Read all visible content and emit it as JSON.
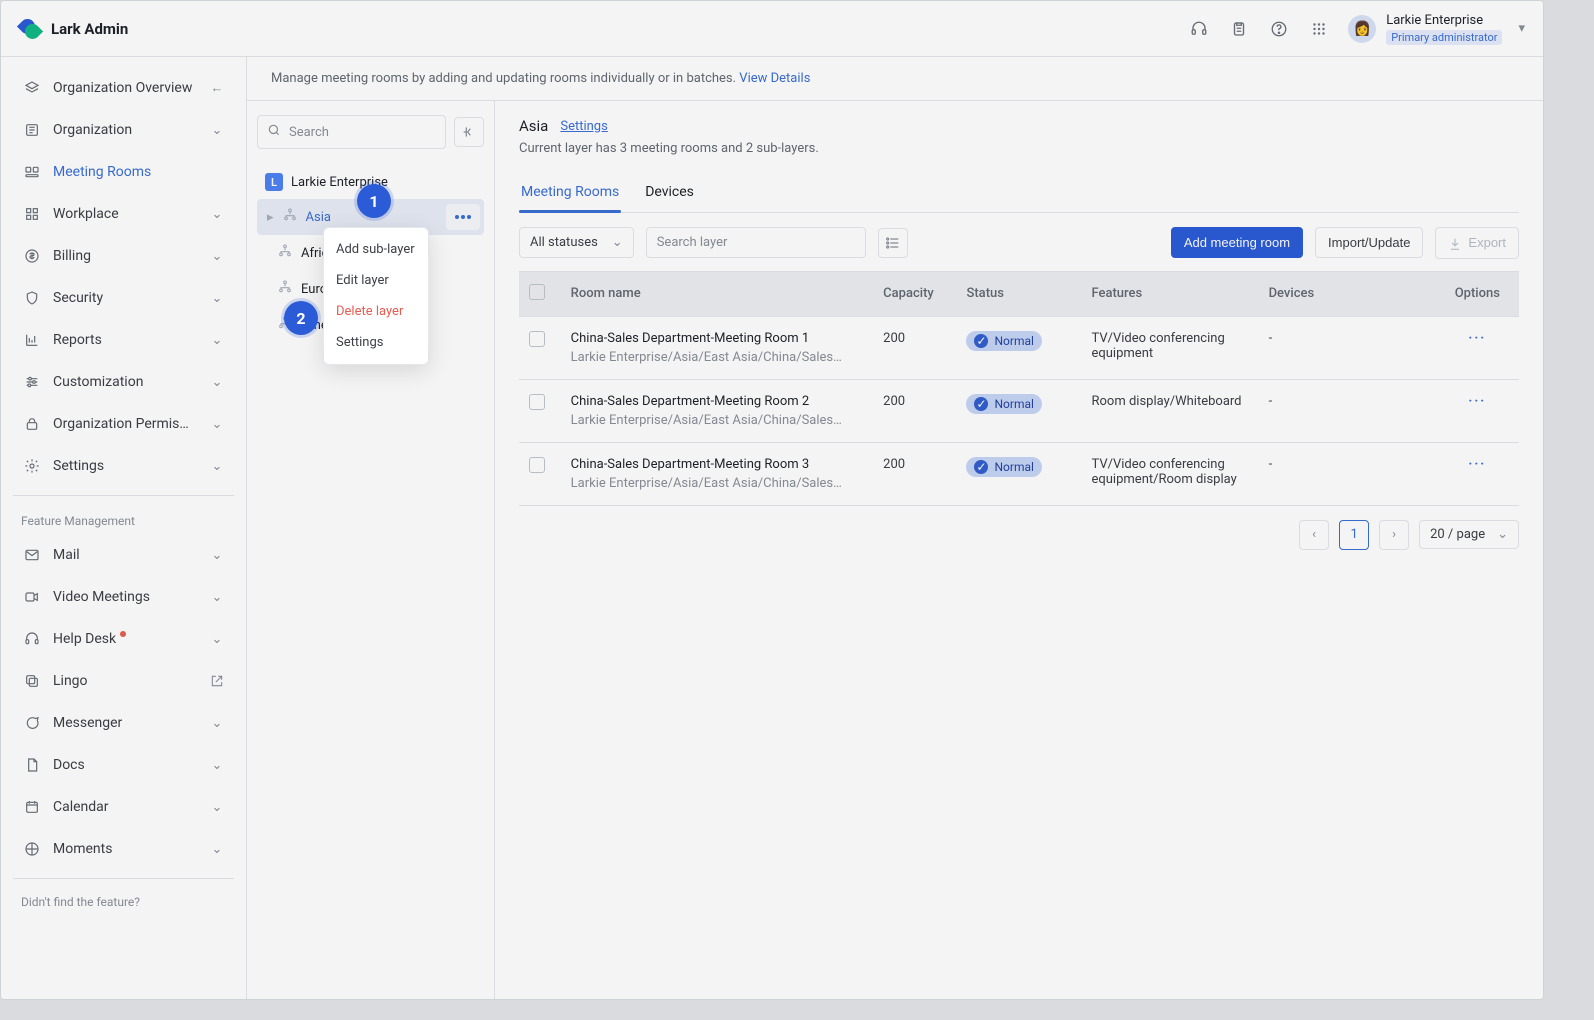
{
  "brand": {
    "name": "Lark Admin"
  },
  "user": {
    "org": "Larkie Enterprise",
    "role": "Primary administrator"
  },
  "sidebar": {
    "items": [
      {
        "label": "Organization Overview",
        "type": "back"
      },
      {
        "label": "Organization",
        "type": "expand"
      },
      {
        "label": "Meeting Rooms",
        "type": "active"
      },
      {
        "label": "Workplace",
        "type": "expand"
      },
      {
        "label": "Billing",
        "type": "expand"
      },
      {
        "label": "Security",
        "type": "expand"
      },
      {
        "label": "Reports",
        "type": "expand"
      },
      {
        "label": "Customization",
        "type": "expand"
      },
      {
        "label": "Organization Permis…",
        "type": "expand"
      },
      {
        "label": "Settings",
        "type": "expand"
      }
    ],
    "feature_title": "Feature Management",
    "features": [
      {
        "label": "Mail",
        "type": "expand"
      },
      {
        "label": "Video Meetings",
        "type": "expand"
      },
      {
        "label": "Help Desk",
        "type": "expand",
        "dot": true
      },
      {
        "label": "Lingo",
        "type": "external"
      },
      {
        "label": "Messenger",
        "type": "expand"
      },
      {
        "label": "Docs",
        "type": "expand"
      },
      {
        "label": "Calendar",
        "type": "expand"
      },
      {
        "label": "Moments",
        "type": "expand"
      }
    ],
    "didnt_find": "Didn't find the feature?"
  },
  "tip": {
    "text": "Manage meeting rooms by adding and updating rooms individually or in batches.",
    "link": "View Details"
  },
  "tree": {
    "search_placeholder": "Search",
    "org": "Larkie Enterprise",
    "nodes": [
      "Asia",
      "Africa",
      "Europe",
      "America"
    ]
  },
  "flyout": {
    "0": "Add sub-layer",
    "1": "Edit layer",
    "2": "Delete layer",
    "3": "Settings"
  },
  "callouts": {
    "one": "1",
    "two": "2"
  },
  "main": {
    "title": "Asia",
    "settings": "Settings",
    "desc": "Current layer has 3 meeting rooms and 2 sub-layers.",
    "tabs": [
      "Meeting Rooms",
      "Devices"
    ],
    "filter_all": "All statuses",
    "search_placeholder": "Search layer",
    "buttons": {
      "add": "Add meeting room",
      "import": "Import/Update",
      "export": "Export"
    },
    "columns": [
      "Room name",
      "Capacity",
      "Status",
      "Features",
      "Devices",
      "Options"
    ],
    "rows": [
      {
        "name": "China-Sales Department-Meeting Room 1",
        "path": "Larkie Enterprise/Asia/East Asia/China/Sales…",
        "capacity": "200",
        "status": "Normal",
        "features": "TV/Video conferencing equipment",
        "devices": "-"
      },
      {
        "name": "China-Sales Department-Meeting Room 2",
        "path": "Larkie Enterprise/Asia/East Asia/China/Sales…",
        "capacity": "200",
        "status": "Normal",
        "features": "Room display/Whiteboard",
        "devices": "-"
      },
      {
        "name": "China-Sales Department-Meeting Room 3",
        "path": "Larkie Enterprise/Asia/East Asia/China/Sales…",
        "capacity": "200",
        "status": "Normal",
        "features": "TV/Video conferencing equipment/Room display",
        "devices": "-"
      }
    ],
    "pager": {
      "current": "1",
      "page_size": "20 / page"
    }
  }
}
